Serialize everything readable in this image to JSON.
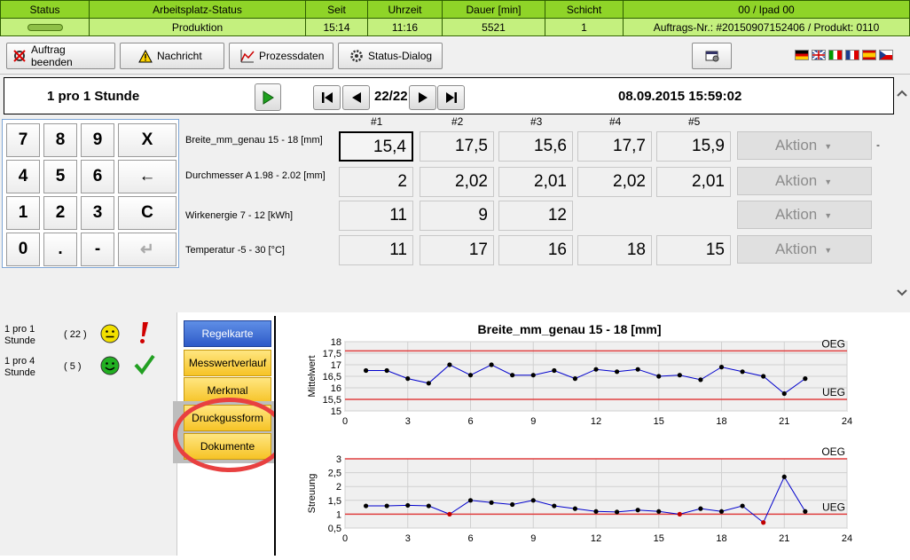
{
  "status_bar": {
    "headers": [
      "Status",
      "Arbeitsplatz-Status",
      "Seit",
      "Uhrzeit",
      "Dauer [min]",
      "Schicht",
      "00  / Ipad 00"
    ],
    "values": [
      "",
      "Produktion",
      "15:14",
      "11:16",
      "5521",
      "1",
      "Auftrags-Nr.: #20150907152406 / Produkt: 0110"
    ]
  },
  "toolbar": {
    "end_order": "Auftrag beenden",
    "message": "Nachricht",
    "process_data": "Prozessdaten",
    "status_dialog": "Status-Dialog"
  },
  "nav": {
    "title": "1 pro 1 Stunde",
    "counter": "22/22",
    "datetime": "08.09.2015 15:59:02"
  },
  "keypad": [
    "7",
    "8",
    "9",
    "X",
    "4",
    "5",
    "6",
    "←",
    "1",
    "2",
    "3",
    "C",
    "0",
    ".",
    "-",
    "↵"
  ],
  "grid": {
    "columns": [
      "#1",
      "#2",
      "#3",
      "#4",
      "#5"
    ],
    "action_label": "Aktion",
    "rows": [
      {
        "label": "Breite_mm_genau 15 - 18 [mm]",
        "values": [
          "15,4",
          "17,5",
          "15,6",
          "17,7",
          "15,9"
        ]
      },
      {
        "label": "Durchmesser A 1.98 - 2.02 [mm]",
        "values": [
          "2",
          "2,02",
          "2,01",
          "2,02",
          "2,01"
        ]
      },
      {
        "label": "Wirkenergie 7 - 12 [kWh]",
        "values": [
          "11",
          "9",
          "12",
          "",
          ""
        ]
      },
      {
        "label": "Temperatur -5 - 30 [°C]",
        "values": [
          "11",
          "17",
          "16",
          "18",
          "15"
        ]
      }
    ],
    "trailing_mark": "-"
  },
  "left_list": [
    {
      "label": "1 pro 1 Stunde",
      "count": "( 22 )",
      "status": "warning"
    },
    {
      "label": "1 pro 4 Stunde",
      "count": "( 5 )",
      "status": "ok"
    }
  ],
  "tabs": [
    "Regelkarte",
    "Messwertverlauf",
    "Merkmal",
    "Druckgussform",
    "Dokumente"
  ],
  "colors": {
    "status_green": "#7fc41c",
    "limit_red": "#e04040",
    "series_blue": "#0000cc",
    "tab_active": "#2e5ac8",
    "tab_yellow": "#f6c326"
  },
  "chart_data": [
    {
      "type": "line",
      "title": "Breite_mm_genau 15 - 18 [mm]",
      "ylabel": "Mittelwert",
      "xlim": [
        0,
        24
      ],
      "ylim": [
        15,
        18
      ],
      "x_ticks": [
        0,
        3,
        6,
        9,
        12,
        15,
        18,
        21,
        24
      ],
      "y_ticks": [
        "15",
        "15,5",
        "16",
        "16,5",
        "17",
        "17,5",
        "18"
      ],
      "limit_labels": [
        "OEG",
        "UEG"
      ],
      "limits": {
        "upper": 17.6,
        "lower": 15.5
      },
      "x": [
        1,
        2,
        3,
        4,
        5,
        6,
        7,
        8,
        9,
        10,
        11,
        12,
        13,
        14,
        15,
        16,
        17,
        18,
        19,
        20,
        21,
        22
      ],
      "values": [
        16.75,
        16.75,
        16.4,
        16.2,
        17.0,
        16.55,
        17.0,
        16.55,
        16.55,
        16.75,
        16.4,
        16.8,
        16.7,
        16.8,
        16.5,
        16.55,
        16.35,
        16.9,
        16.7,
        16.5,
        15.75,
        16.4
      ],
      "grid": true
    },
    {
      "type": "line",
      "title": "",
      "ylabel": "Streuung",
      "xlim": [
        0,
        24
      ],
      "ylim": [
        0.5,
        3
      ],
      "x_ticks": [
        0,
        3,
        6,
        9,
        12,
        15,
        18,
        21,
        24
      ],
      "y_ticks": [
        "0,5",
        "1",
        "1,5",
        "2",
        "2,5",
        "3"
      ],
      "limit_labels": [
        "OEG",
        "UEG"
      ],
      "limits": {
        "upper": 3.0,
        "lower": 1.0
      },
      "x": [
        1,
        2,
        3,
        4,
        5,
        6,
        7,
        8,
        9,
        10,
        11,
        12,
        13,
        14,
        15,
        16,
        17,
        18,
        19,
        20,
        21,
        22
      ],
      "values": [
        1.3,
        1.3,
        1.32,
        1.3,
        1.0,
        1.5,
        1.42,
        1.35,
        1.5,
        1.3,
        1.2,
        1.1,
        1.08,
        1.15,
        1.1,
        1.0,
        1.2,
        1.1,
        1.3,
        0.7,
        2.35,
        1.1
      ],
      "red_points": [
        5,
        16,
        20
      ],
      "grid": true
    }
  ]
}
